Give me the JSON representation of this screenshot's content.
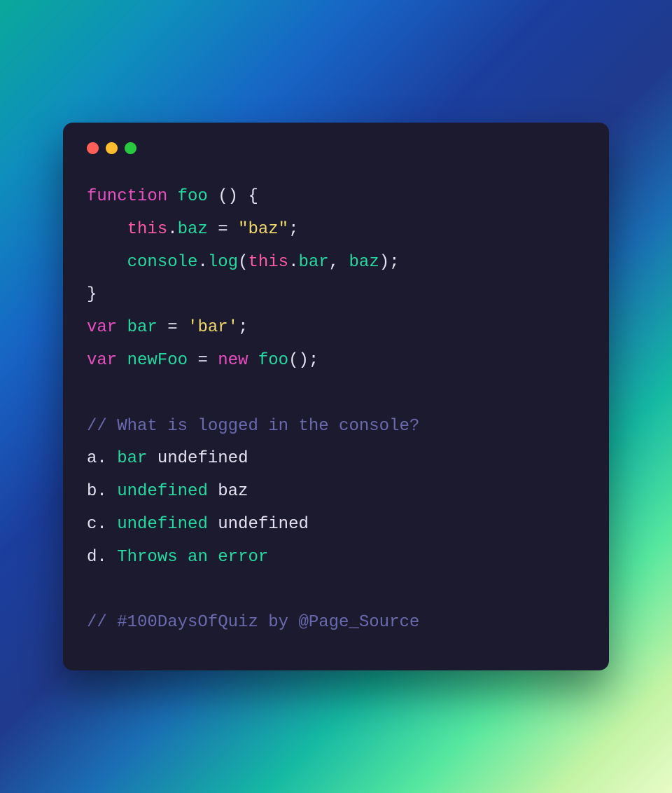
{
  "code": {
    "l1": {
      "kw": "function",
      "name": "foo",
      "paren": " () {"
    },
    "l2": {
      "indent": "    ",
      "this": "this",
      "dot": ".",
      "prop": "baz",
      "eq": " = ",
      "str": "\"baz\"",
      "semi": ";"
    },
    "l3": {
      "indent": "    ",
      "obj": "console",
      "dot1": ".",
      "fn": "log",
      "open": "(",
      "this": "this",
      "dot2": ".",
      "prop": "bar",
      "comma": ", ",
      "arg2": "baz",
      "close": ");"
    },
    "l4": {
      "close": "}"
    },
    "l5": {
      "kw": "var",
      "name": " bar ",
      "eq": "= ",
      "str": "'bar'",
      "semi": ";"
    },
    "l6": {
      "kw": "var",
      "name": " newFoo ",
      "eq": "= ",
      "new": "new",
      "sp": " ",
      "fn": "foo",
      "call": "();"
    }
  },
  "question": "// What is logged in the console?",
  "answers": {
    "a": {
      "letter": "a",
      "dot": ". ",
      "p1": "bar",
      "sp": " ",
      "p2": "undefined"
    },
    "b": {
      "letter": "b",
      "dot": ". ",
      "p1": "undefined",
      "sp": " ",
      "p2": "baz"
    },
    "c": {
      "letter": "c",
      "dot": ". ",
      "p1": "undefined",
      "sp": " ",
      "p2": "undefined"
    },
    "d": {
      "letter": "d",
      "dot": ". ",
      "p1": "Throws",
      "sp1": " ",
      "p2": "an",
      "sp2": " ",
      "p3": "error"
    }
  },
  "footer": "// #100DaysOfQuiz by @Page_Source"
}
